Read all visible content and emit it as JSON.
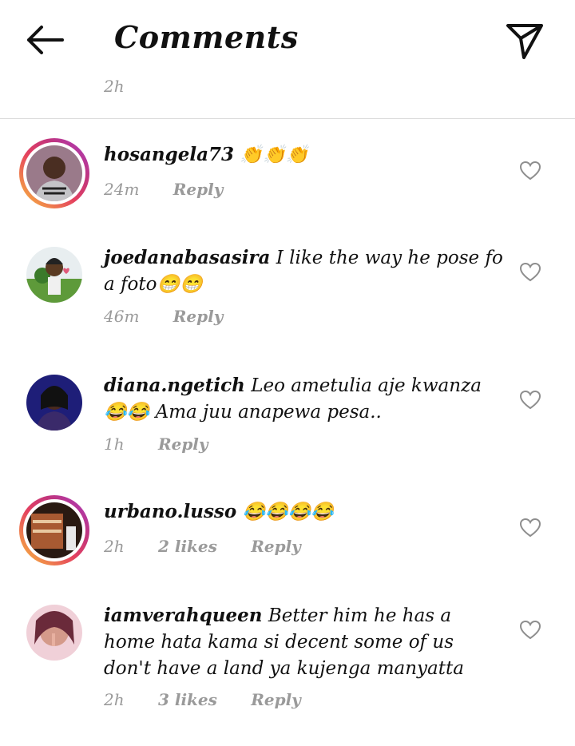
{
  "header": {
    "title": "Comments",
    "back_icon": "arrow-left-icon",
    "send_icon": "paper-plane-icon"
  },
  "top_time": "2h",
  "comments": [
    {
      "username": "hosangela73",
      "text": "👏👏👏",
      "time": "24m",
      "likes": "",
      "reply": "Reply",
      "has_story_ring": true,
      "avatar_color": "#7b5c6a"
    },
    {
      "username": "joedanabasasira",
      "text": "I like the way he pose fo a foto😁😁",
      "time": "46m",
      "likes": "",
      "reply": "Reply",
      "has_story_ring": false,
      "avatar_color": "#4e8a3a"
    },
    {
      "username": "diana.ngetich",
      "text": "Leo ametulia aje kwanza😂😂 Ama juu anapewa pesa..",
      "time": "1h",
      "likes": "",
      "reply": "Reply",
      "has_story_ring": false,
      "avatar_color": "#2a2a8a"
    },
    {
      "username": "urbano.lusso",
      "text": "😂😂😂😂",
      "time": "2h",
      "likes": "2 likes",
      "reply": "Reply",
      "has_story_ring": true,
      "avatar_color": "#8a4a2a"
    },
    {
      "username": "iamverahqueen",
      "text": "Better him he has a home hata kama si decent some of us  don't have a land ya kujenga manyatta",
      "time": "2h",
      "likes": "3 likes",
      "reply": "Reply",
      "has_story_ring": false,
      "avatar_color": "#d48a9a"
    }
  ],
  "colors": {
    "muted": "#9a9a9a",
    "divider": "#dbdbdb",
    "story_ring": [
      "#f9c23c",
      "#e4405f",
      "#a53bc4"
    ]
  }
}
